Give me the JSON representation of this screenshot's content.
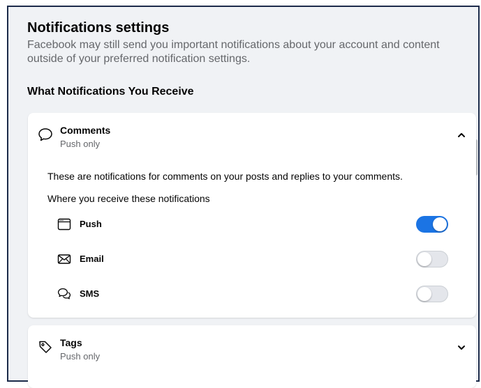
{
  "header": {
    "title": "Notifications settings",
    "description": "Facebook may still send you important notifications about your account and content outside of your preferred notification settings."
  },
  "section": {
    "heading": "What Notifications You Receive"
  },
  "comments": {
    "title": "Comments",
    "subtitle": "Push only",
    "expanded": true,
    "description": "These are notifications for comments on your posts and replies to your comments.",
    "where_label": "Where you receive these notifications",
    "channels": [
      {
        "label": "Push",
        "icon": "browser-window-icon",
        "enabled": true
      },
      {
        "label": "Email",
        "icon": "envelope-icon",
        "enabled": false
      },
      {
        "label": "SMS",
        "icon": "chat-bubbles-icon",
        "enabled": false
      }
    ]
  },
  "tags": {
    "title": "Tags",
    "subtitle": "Push only",
    "expanded": false
  },
  "colors": {
    "accent": "#1b74e4",
    "background": "#f0f2f5",
    "secondary_text": "#65676b",
    "toggle_off": "#e4e6eb"
  }
}
